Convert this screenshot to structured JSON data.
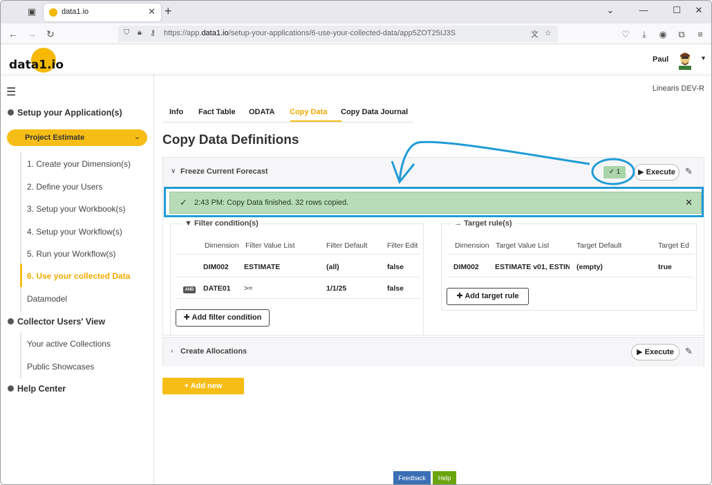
{
  "browser": {
    "tab_title": "data1.io",
    "url_prefix": "https://app.",
    "url_domain": "data1.io",
    "url_path": "/setup-your-applications/6-use-your-collected-data/app5ZOT25IJ3S"
  },
  "header": {
    "logo_text": "data1.io",
    "user_name": "Paul",
    "environment": "Linearis DEV-R"
  },
  "sidebar": {
    "section_setup": "Setup your Application(s)",
    "project": "Project Estimate",
    "steps": [
      "1. Create your Dimension(s)",
      "2. Define your Users",
      "3. Setup your Workbook(s)",
      "4. Setup your Workflow(s)",
      "5. Run your Workflow(s)",
      "6. Use your collected Data",
      "Datamodel"
    ],
    "section_collector": "Collector Users' View",
    "collector_items": [
      "Your active Collections",
      "Public Showcases"
    ],
    "section_help": "Help Center"
  },
  "tabs": [
    "Info",
    "Fact Table",
    "ODATA",
    "Copy Data",
    "Copy Data Journal"
  ],
  "page_title": "Copy Data Definitions",
  "definition1": {
    "title": "Freeze Current Forecast",
    "badge": "1",
    "execute_label": "Execute",
    "notification": "2:43 PM: Copy Data finished. 32 rows copied.",
    "filter": {
      "title": "Filter condition(s)",
      "headers": [
        "Dimension",
        "Filter Value List",
        "Filter Default",
        "Filter Edit"
      ],
      "rows": [
        {
          "logic": "",
          "dimension": "DIM002",
          "value_list": "ESTIMATE",
          "default": "(all)",
          "edit": "false"
        },
        {
          "logic": "AND",
          "dimension": "DATE01",
          "value_list": ">=",
          "default": "1/1/25",
          "edit": "false"
        }
      ],
      "add_label": "Add filter condition"
    },
    "target": {
      "title": "Target rule(s)",
      "headers": [
        "Dimension",
        "Target Value List",
        "Target Default",
        "Target Ed"
      ],
      "rows": [
        {
          "dimension": "DIM002",
          "value_list": "ESTIMATE v01, ESTIN",
          "default": "(empty)",
          "edit": "true"
        }
      ],
      "add_label": "Add target rule"
    }
  },
  "definition2": {
    "title": "Create Allocations",
    "execute_label": "Execute"
  },
  "add_new_label": "Add new",
  "footer": {
    "feedback": "Feedback",
    "help": "Help"
  },
  "colors": {
    "accent": "#f6bd16",
    "annotation": "#1f9bd6",
    "success_bg": "#b8dbb8"
  }
}
